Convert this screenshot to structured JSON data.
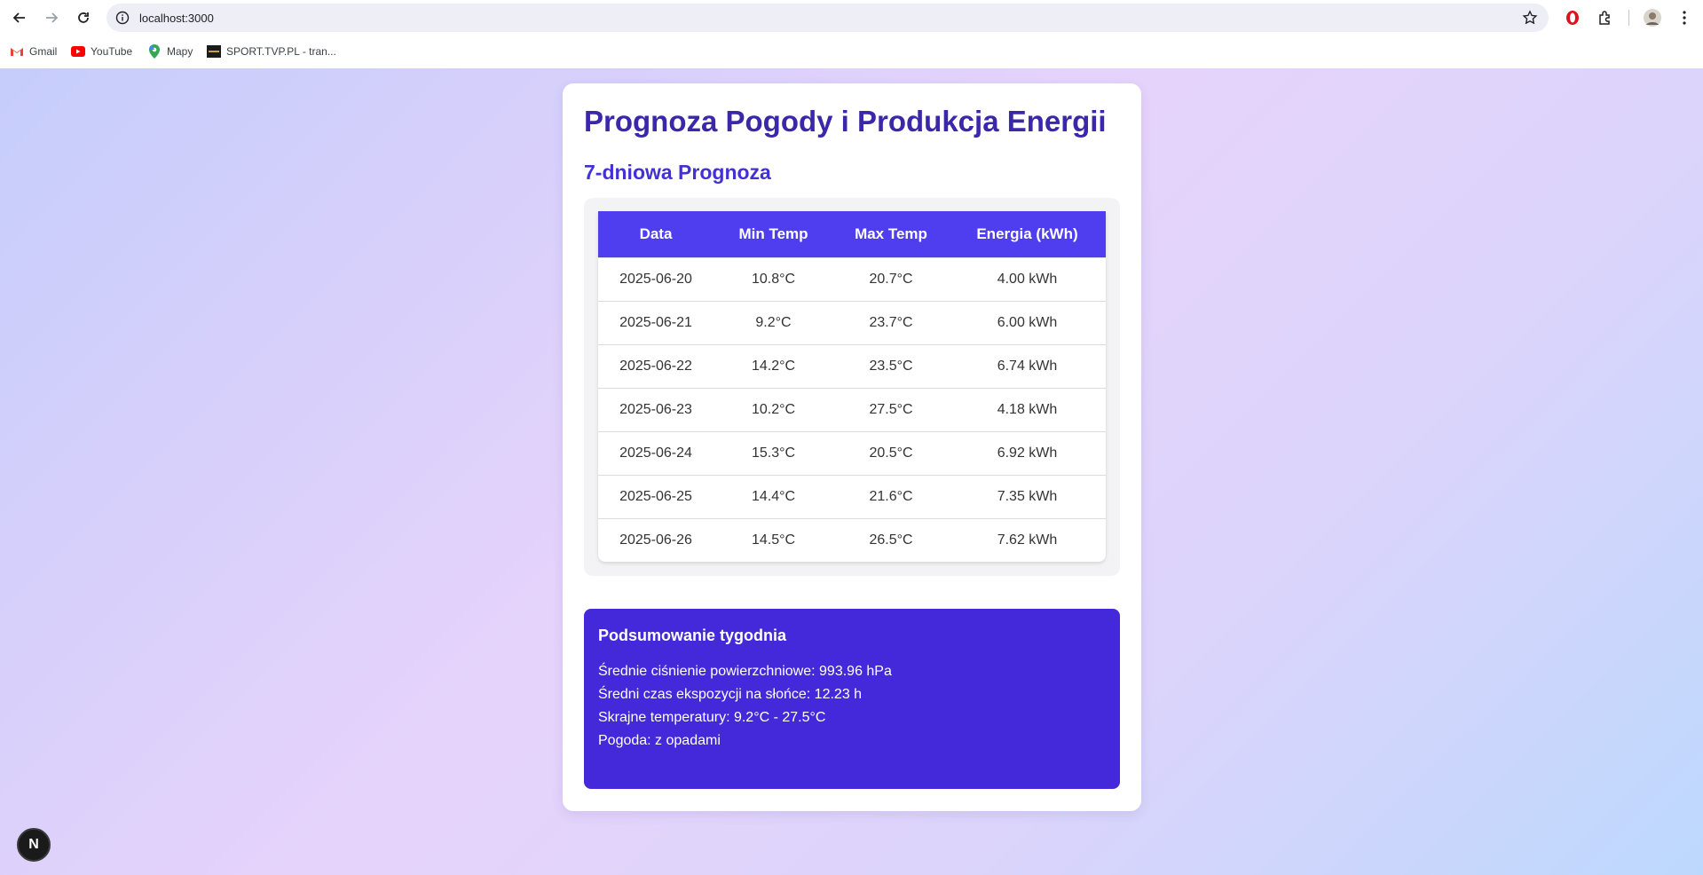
{
  "browser": {
    "url": "localhost:3000",
    "bookmarks": [
      "Gmail",
      "YouTube",
      "Mapy",
      "SPORT.TVP.PL - tran..."
    ]
  },
  "page": {
    "title": "Prognoza Pogody i Produkcja Energii",
    "subtitle": "7-dniowa Prognoza",
    "table": {
      "headers": [
        "Data",
        "Min Temp",
        "Max Temp",
        "Energia (kWh)"
      ],
      "rows": [
        [
          "2025-06-20",
          "10.8°C",
          "20.7°C",
          "4.00 kWh"
        ],
        [
          "2025-06-21",
          "9.2°C",
          "23.7°C",
          "6.00 kWh"
        ],
        [
          "2025-06-22",
          "14.2°C",
          "23.5°C",
          "6.74 kWh"
        ],
        [
          "2025-06-23",
          "10.2°C",
          "27.5°C",
          "4.18 kWh"
        ],
        [
          "2025-06-24",
          "15.3°C",
          "20.5°C",
          "6.92 kWh"
        ],
        [
          "2025-06-25",
          "14.4°C",
          "21.6°C",
          "7.35 kWh"
        ],
        [
          "2025-06-26",
          "14.5°C",
          "26.5°C",
          "7.62 kWh"
        ]
      ]
    },
    "summary": {
      "title": "Podsumowanie tygodnia",
      "lines": [
        "Średnie ciśnienie powierzchniowe: 993.96 hPa",
        "Średni czas ekspozycji na słońce: 12.23 h",
        "Skrajne temperatury: 9.2°C - 27.5°C",
        "Pogoda: z opadami"
      ]
    },
    "badge": "N"
  },
  "colors": {
    "title": "#3b27a9",
    "subtitle": "#4331d1",
    "table_header": "#4f3ef0",
    "summary_bg": "#4329d9"
  }
}
